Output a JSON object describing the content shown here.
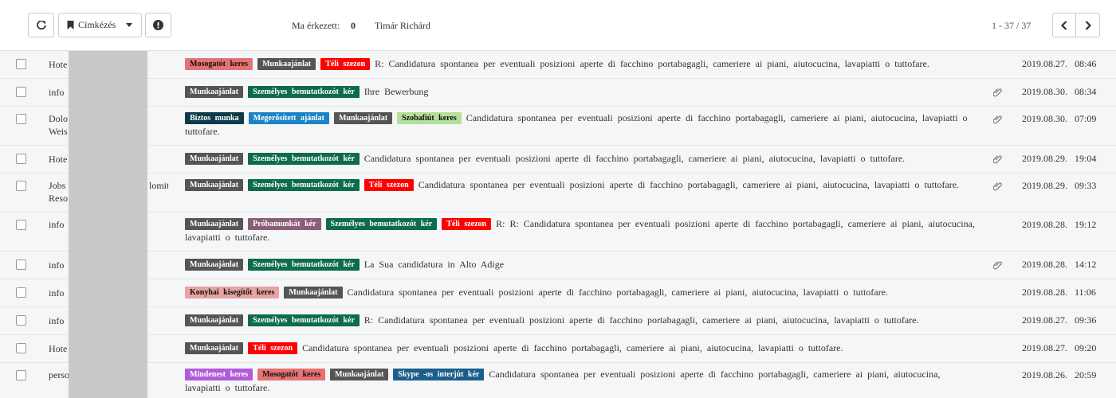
{
  "toolbar": {
    "label_button": "Címkézés",
    "today_label": "Ma érkezett:",
    "today_count": "0",
    "user_name": "Timár Richárd",
    "pager_text": "1 - 37 / 37"
  },
  "colors": {
    "Mosogatót keres": "#e57373",
    "Munkaajánlat": "#555555",
    "Téli szezon": "#ff0000",
    "Személyes bemutatkozót kér": "#0d6b4e",
    "Biztos munka": "#0c3a4a",
    "Megerősített ajánlat": "#1a84c4",
    "Szobafiút keres": "#b4e09a",
    "Próbamunkát kér": "#8a5e77",
    "Konyhai kisegítőt keres": "#e8a3a3",
    "Mindenest keres": "#b25ad8",
    "Skype -os interjút kér": "#1c5e8a"
  },
  "rows": [
    {
      "sender": "Hote",
      "sender2": "",
      "tags": [
        "Mosogatót keres",
        "Munkaajánlat",
        "Téli szezon"
      ],
      "subject": "R: Candidatura spontanea per eventuali posizioni aperte di facchino portabagagli, cameriere ai piani, aiutocucina, lavapiatti o tuttofare.",
      "attachment": false,
      "date": "2019.08.27. 08:46"
    },
    {
      "sender": "info",
      "sender2": "",
      "tags": [
        "Munkaajánlat",
        "Személyes bemutatkozót kér"
      ],
      "subject": "Ihre Bewerbung",
      "attachment": true,
      "date": "2019.08.30. 08:34"
    },
    {
      "sender": "Dolo",
      "sender2": "Weis",
      "tags": [
        "Biztos munka",
        "Megerősített ajánlat",
        "Munkaajánlat",
        "Szobafiút keres"
      ],
      "subject": "Candidatura spontanea per eventuali posizioni aperte di facchino portabagagli, cameriere ai piani, aiutocucina, lavapiatti o tuttofare.",
      "attachment": true,
      "date": "2019.08.30. 07:09"
    },
    {
      "sender": "Hote",
      "sender2": "",
      "tags": [
        "Munkaajánlat",
        "Személyes bemutatkozót kér"
      ],
      "subject": "Candidatura spontanea per eventuali posizioni aperte di facchino portabagagli, cameriere ai piani, aiutocucina, lavapiatti o tuttofare.",
      "attachment": true,
      "date": "2019.08.29. 19:04"
    },
    {
      "sender": "Jobs",
      "sender_suffix": "lomit",
      "sender2": "Reso",
      "tags": [
        "Munkaajánlat",
        "Személyes bemutatkozót kér",
        "Téli szezon"
      ],
      "subject": "Candidatura spontanea per eventuali posizioni aperte di facchino portabagagli, cameriere ai piani, aiutocucina, lavapiatti o tuttofare.",
      "attachment": true,
      "date": "2019.08.29. 09:33"
    },
    {
      "sender": "info",
      "sender2": "",
      "tags": [
        "Munkaajánlat",
        "Próbamunkát kér",
        "Személyes bemutatkozót kér",
        "Téli szezon"
      ],
      "subject": "R: R: Candidatura spontanea per eventuali posizioni aperte di facchino portabagagli, cameriere ai piani, aiutocucina, lavapiatti o tuttofare.",
      "attachment": false,
      "date": "2019.08.28. 19:12"
    },
    {
      "sender": "info",
      "sender2": "",
      "tags": [
        "Munkaajánlat",
        "Személyes bemutatkozót kér"
      ],
      "subject": "La Sua candidatura in Alto Adige",
      "attachment": true,
      "date": "2019.08.28. 14:12"
    },
    {
      "sender": "info",
      "sender2": "",
      "tags": [
        "Konyhai kisegítőt keres",
        "Munkaajánlat"
      ],
      "subject": "Candidatura spontanea per eventuali posizioni aperte di facchino portabagagli, cameriere ai piani, aiutocucina, lavapiatti o tuttofare.",
      "attachment": false,
      "date": "2019.08.28. 11:06"
    },
    {
      "sender": "info",
      "sender2": "",
      "tags": [
        "Munkaajánlat",
        "Személyes bemutatkozót kér"
      ],
      "subject": "R: Candidatura spontanea per eventuali posizioni aperte di facchino portabagagli, cameriere ai piani, aiutocucina, lavapiatti o tuttofare.",
      "attachment": false,
      "date": "2019.08.27. 09:36"
    },
    {
      "sender": "Hote",
      "sender2": "",
      "tags": [
        "Munkaajánlat",
        "Téli szezon"
      ],
      "subject": "Candidatura spontanea per eventuali posizioni aperte di facchino portabagagli, cameriere ai piani, aiutocucina, lavapiatti o tuttofare.",
      "attachment": false,
      "date": "2019.08.27. 09:20"
    },
    {
      "sender": "perso",
      "sender2": "",
      "tags": [
        "Mindenest keres",
        "Mosogatót keres",
        "Munkaajánlat",
        "Skype -os interjút kér"
      ],
      "subject": "Candidatura spontanea per eventuali posizioni aperte di facchino portabagagli, cameriere ai piani, aiutocucina, lavapiatti o tuttofare.",
      "attachment": false,
      "date": "2019.08.26. 20:59"
    }
  ]
}
